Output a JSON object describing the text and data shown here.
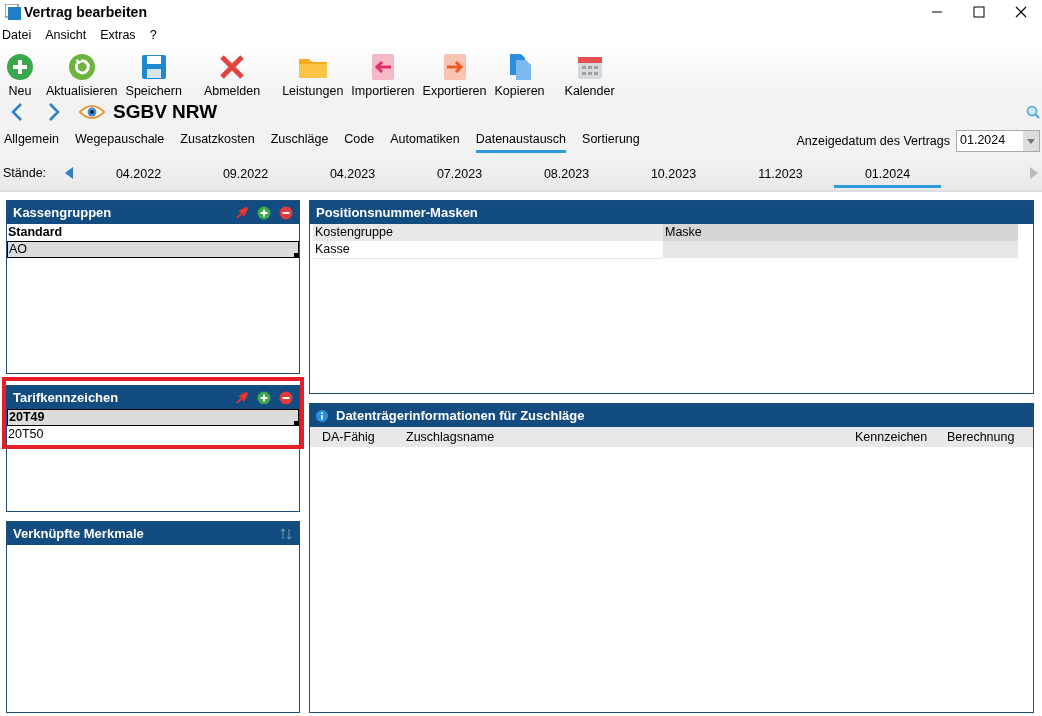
{
  "window": {
    "title": "Vertrag bearbeiten"
  },
  "menu": [
    "Datei",
    "Ansicht",
    "Extras",
    "?"
  ],
  "toolbar": [
    {
      "label": "Neu",
      "kind": "add"
    },
    {
      "label": "Aktualisieren",
      "kind": "refresh"
    },
    {
      "label": "Speichern",
      "kind": "save"
    },
    {
      "label": "Abmelden",
      "kind": "cancel"
    },
    {
      "label": "Leistungen",
      "kind": "folder"
    },
    {
      "label": "Importieren",
      "kind": "import"
    },
    {
      "label": "Exportieren",
      "kind": "export"
    },
    {
      "label": "Kopieren",
      "kind": "copy"
    },
    {
      "label": "Kalender",
      "kind": "calendar"
    }
  ],
  "record": {
    "title": "SGBV NRW"
  },
  "tabs": [
    {
      "label": "Allgemein",
      "selected": false
    },
    {
      "label": "Wegepauschale",
      "selected": false
    },
    {
      "label": "Zusatzkosten",
      "selected": false
    },
    {
      "label": "Zuschläge",
      "selected": false
    },
    {
      "label": "Code",
      "selected": false
    },
    {
      "label": "Automatiken",
      "selected": false
    },
    {
      "label": "Datenaustausch",
      "selected": true
    },
    {
      "label": "Sortierung",
      "selected": false
    }
  ],
  "display_date": {
    "label": "Anzeigedatum des Vertrags",
    "value": "01.2024"
  },
  "versions": {
    "label": "Stände:",
    "items": [
      {
        "label": "04.2022",
        "selected": false
      },
      {
        "label": "09.2022",
        "selected": false
      },
      {
        "label": "04.2023",
        "selected": false
      },
      {
        "label": "07.2023",
        "selected": false
      },
      {
        "label": "08.2023",
        "selected": false
      },
      {
        "label": "10.2023",
        "selected": false
      },
      {
        "label": "11.2023",
        "selected": false
      },
      {
        "label": "01.2024",
        "selected": true
      }
    ]
  },
  "left_panels": [
    {
      "title": "Kassengruppen",
      "tools": [
        {
          "kind": "pin",
          "disabled": false
        },
        {
          "kind": "add",
          "disabled": false
        },
        {
          "kind": "remove",
          "disabled": false
        }
      ],
      "items": [
        {
          "label": "Standard",
          "bold": true,
          "selected": false
        },
        {
          "label": "AO",
          "bold": false,
          "selected": true
        }
      ]
    },
    {
      "title": "Tarifkennzeichen",
      "tools": [
        {
          "kind": "pin",
          "disabled": false
        },
        {
          "kind": "add",
          "disabled": false
        },
        {
          "kind": "remove",
          "disabled": false
        }
      ],
      "items": [
        {
          "label": "20T49",
          "bold": true,
          "selected": true
        },
        {
          "label": "20T50",
          "bold": false,
          "selected": false
        }
      ]
    },
    {
      "title": "Verknüpfte Merkmale",
      "tools": [
        {
          "kind": "sort",
          "disabled": true
        }
      ]
    }
  ],
  "masks": {
    "title": "Positionsnummer-Masken",
    "columns": [
      "Kostengruppe",
      "Maske"
    ],
    "rows": [
      [
        "Kasse"
      ]
    ]
  },
  "surcharges": {
    "title": "Datenträgerinformationen für Zuschläge",
    "columns": [
      "DA-Fähig",
      "Zuschlagsname",
      "Kennzeichen",
      "Berechnung"
    ]
  }
}
